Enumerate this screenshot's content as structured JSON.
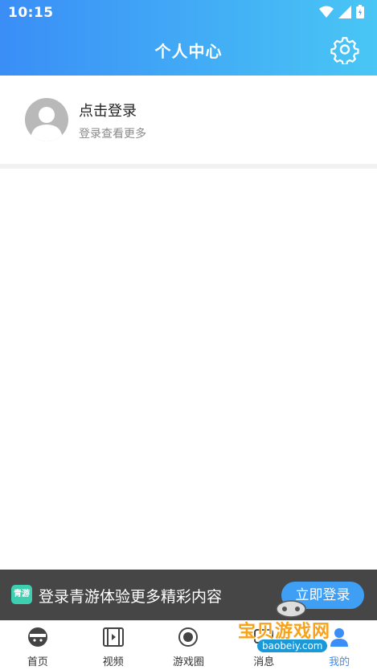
{
  "status_bar": {
    "time": "10:15"
  },
  "header": {
    "title": "个人中心"
  },
  "profile": {
    "login_title": "点击登录",
    "login_subtitle": "登录查看更多"
  },
  "banner": {
    "logo_text": "青游",
    "text": "登录青游体验更多精彩内容",
    "button_label": "立即登录"
  },
  "tabs": [
    {
      "label": "首页",
      "icon": "home-face-icon"
    },
    {
      "label": "视频",
      "icon": "film-icon"
    },
    {
      "label": "游戏圈",
      "icon": "planet-icon"
    },
    {
      "label": "消息",
      "icon": "message-icon"
    },
    {
      "label": "我的",
      "icon": "user-icon",
      "active": true
    }
  ],
  "watermark": {
    "text": "宝贝游戏网",
    "url": "baobeiy.com"
  },
  "colors": {
    "header_start": "#3a8ef6",
    "header_end": "#49c6f5",
    "accent": "#3a8ef6",
    "button": "#3f9ff5"
  }
}
